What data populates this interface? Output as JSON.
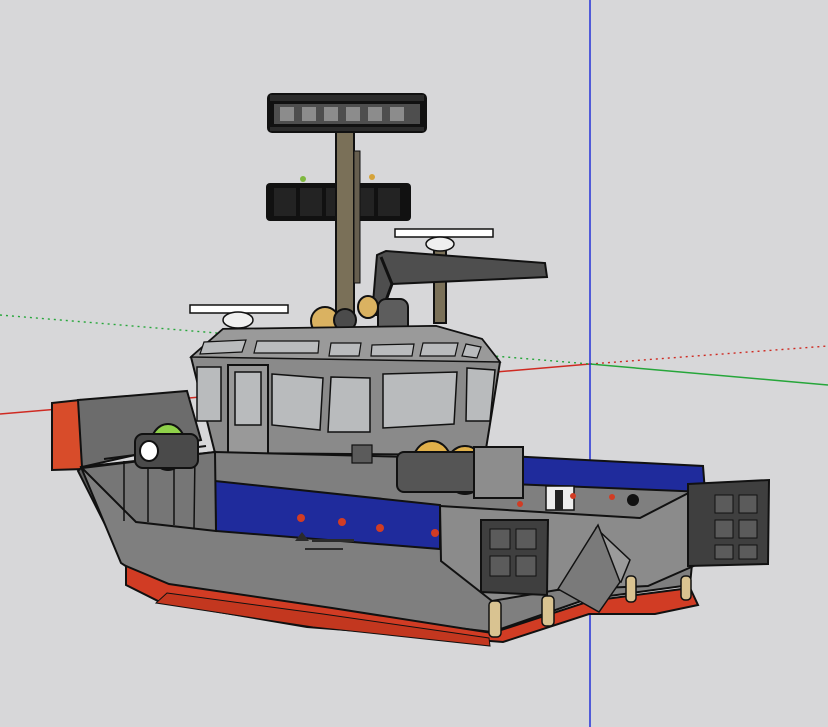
{
  "viewport": {
    "background": "#d7d7d9"
  },
  "axes": {
    "red_axis_color": "#cf2a22",
    "green_axis_color": "#26a63a",
    "blue_axis_color": "#2430d8"
  },
  "model": {
    "hull_color": "#7f7f7f",
    "hull_dark": "#5b5b5b",
    "bottom_color": "#d13c24",
    "stripe_color": "#1f2b9c",
    "cabin_color": "#8a8a8a",
    "window_color": "#b9bbbd",
    "mast_color": "#7a7058",
    "winch_color": "#e0b04a",
    "accent_green": "#8fd14a",
    "outline": "#111111"
  }
}
